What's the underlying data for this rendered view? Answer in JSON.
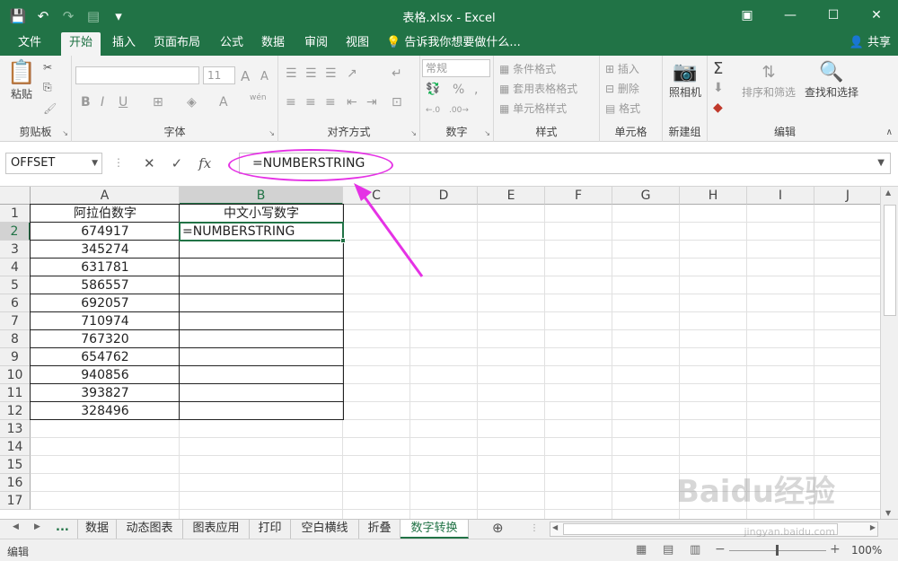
{
  "window": {
    "title": "表格.xlsx - Excel",
    "ribbon_display_icon": "ribbon-display-icon",
    "minimize": "—",
    "maximize": "☐",
    "close": "✕"
  },
  "qat": {
    "save_icon": "💾",
    "undo_icon": "↶",
    "redo_icon": "↷",
    "form_icon": "▤",
    "more_icon": "▾"
  },
  "tabs": [
    {
      "label": "文件"
    },
    {
      "label": "开始"
    },
    {
      "label": "插入"
    },
    {
      "label": "页面布局"
    },
    {
      "label": "公式"
    },
    {
      "label": "数据"
    },
    {
      "label": "审阅"
    },
    {
      "label": "视图"
    }
  ],
  "tellme": "告诉我你想要做什么...",
  "share": "共享",
  "ribbon": {
    "clipboard": {
      "label": "剪贴板",
      "paste": "粘贴"
    },
    "font": {
      "label": "字体",
      "size": "11",
      "bold": "B",
      "italic": "I",
      "underline": "U",
      "grow": "A",
      "shrink": "A",
      "font_color": "A",
      "wen": "wén"
    },
    "alignment": {
      "label": "对齐方式"
    },
    "number": {
      "label": "数字",
      "format": "常规",
      "percent": "%",
      "comma": ","
    },
    "styles": {
      "label": "样式",
      "cond": "条件格式",
      "table": "套用表格格式",
      "cell": "单元格样式"
    },
    "cells": {
      "label": "单元格",
      "insert": "插入",
      "delete": "删除",
      "format": "格式"
    },
    "newgroup": {
      "label": "新建组",
      "camera": "照相机"
    },
    "editing": {
      "label": "编辑",
      "sum": "Σ",
      "sort": "排序和筛选",
      "find": "查找和选择"
    }
  },
  "formula_bar": {
    "name_box": "OFFSET",
    "cancel": "✕",
    "enter": "✓",
    "fx": "fx",
    "formula": "=NUMBERSTRING"
  },
  "columns": [
    "A",
    "B",
    "C",
    "D",
    "E",
    "F",
    "G",
    "H",
    "I",
    "J"
  ],
  "rows": [
    "1",
    "2",
    "3",
    "4",
    "5",
    "6",
    "7",
    "8",
    "9",
    "10",
    "11",
    "12",
    "13",
    "14",
    "15",
    "16",
    "17"
  ],
  "table": {
    "header_a": "阿拉伯数字",
    "header_b": "中文小写数字",
    "b2": "=NUMBERSTRING",
    "values": [
      "674917",
      "345274",
      "631781",
      "586557",
      "692057",
      "710974",
      "767320",
      "654762",
      "940856",
      "393827",
      "328496"
    ]
  },
  "sheets": [
    {
      "label": "数据"
    },
    {
      "label": "动态图表"
    },
    {
      "label": "图表应用"
    },
    {
      "label": "打印"
    },
    {
      "label": "空白横线"
    },
    {
      "label": "折叠"
    },
    {
      "label": "数字转换"
    }
  ],
  "sheet_nav": {
    "prev": "◀",
    "next": "▶",
    "more": "...",
    "add": "⊕"
  },
  "status": {
    "mode": "编辑",
    "zoom": "100%",
    "minus": "−",
    "plus": "+"
  },
  "watermark": {
    "logo": "Baidu经验",
    "url": "jingyan.baidu.com"
  },
  "colors": {
    "accent": "#217346",
    "annotation": "#e532e5"
  }
}
